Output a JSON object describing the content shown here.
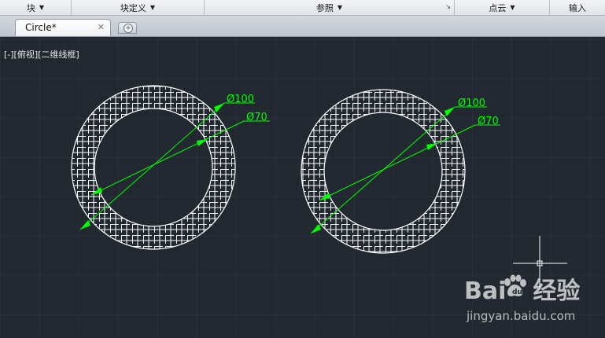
{
  "ribbon": {
    "panels": [
      {
        "label": "块",
        "dropdown": true
      },
      {
        "label": "块定义",
        "dropdown": true
      },
      {
        "label": "参照",
        "dropdown": true,
        "launcher": true
      },
      {
        "label": "点云",
        "dropdown": true
      },
      {
        "label": "输入",
        "dropdown": false
      }
    ]
  },
  "tabs": {
    "active_label": "Circle*",
    "close_symbol": "✕",
    "new_tab_symbol": "+"
  },
  "viewport": {
    "label": "[-][俯视][二维线框]"
  },
  "drawing": {
    "background_color": "#212830",
    "grid_color": "#2b333d",
    "hatch_color": "#ffffff",
    "dimension_color": "#00ff00",
    "left_circle": {
      "outer_dim": "Ø100",
      "inner_dim": "Ø70"
    },
    "right_circle": {
      "outer_dim": "Ø100",
      "inner_dim": "Ø70"
    }
  },
  "watermark": {
    "logo_left": "Bai",
    "logo_right": "经验",
    "url": "jingyan.baidu.com"
  }
}
